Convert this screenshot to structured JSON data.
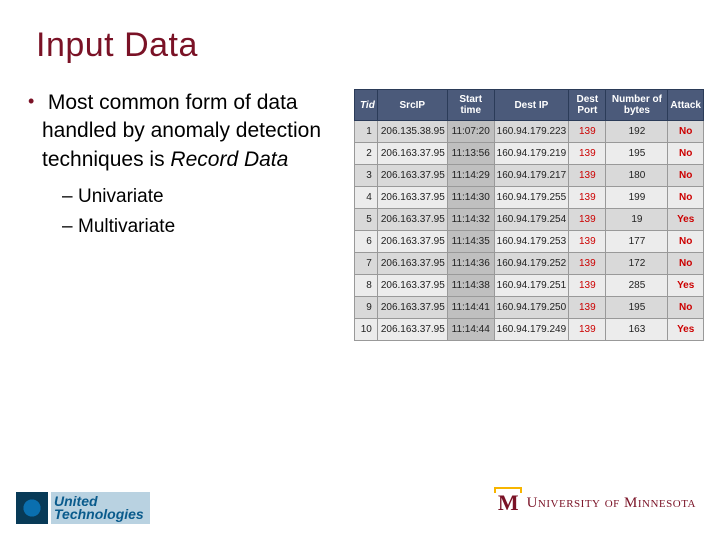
{
  "title": "Input Data",
  "bullets": {
    "main_prefix": "Most common form of data handled by anomaly detection techniques is ",
    "main_emph": "Record Data",
    "sub1": "Univariate",
    "sub2": "Multivariate"
  },
  "table": {
    "headers": {
      "tid": "Tid",
      "srcip": "SrcIP",
      "stime": "Start time",
      "destip": "Dest IP",
      "destport": "Dest Port",
      "nbytes": "Number of bytes",
      "attack": "Attack"
    },
    "rows": [
      {
        "tid": "1",
        "srcip": "206.135.38.95",
        "stime": "11:07:20",
        "destip": "160.94.179.223",
        "destport": "139",
        "nbytes": "192",
        "attack": "No"
      },
      {
        "tid": "2",
        "srcip": "206.163.37.95",
        "stime": "11:13:56",
        "destip": "160.94.179.219",
        "destport": "139",
        "nbytes": "195",
        "attack": "No"
      },
      {
        "tid": "3",
        "srcip": "206.163.37.95",
        "stime": "11:14:29",
        "destip": "160.94.179.217",
        "destport": "139",
        "nbytes": "180",
        "attack": "No"
      },
      {
        "tid": "4",
        "srcip": "206.163.37.95",
        "stime": "11:14:30",
        "destip": "160.94.179.255",
        "destport": "139",
        "nbytes": "199",
        "attack": "No"
      },
      {
        "tid": "5",
        "srcip": "206.163.37.95",
        "stime": "11:14:32",
        "destip": "160.94.179.254",
        "destport": "139",
        "nbytes": "19",
        "attack": "Yes"
      },
      {
        "tid": "6",
        "srcip": "206.163.37.95",
        "stime": "11:14:35",
        "destip": "160.94.179.253",
        "destport": "139",
        "nbytes": "177",
        "attack": "No"
      },
      {
        "tid": "7",
        "srcip": "206.163.37.95",
        "stime": "11:14:36",
        "destip": "160.94.179.252",
        "destport": "139",
        "nbytes": "172",
        "attack": "No"
      },
      {
        "tid": "8",
        "srcip": "206.163.37.95",
        "stime": "11:14:38",
        "destip": "160.94.179.251",
        "destport": "139",
        "nbytes": "285",
        "attack": "Yes"
      },
      {
        "tid": "9",
        "srcip": "206.163.37.95",
        "stime": "11:14:41",
        "destip": "160.94.179.250",
        "destport": "139",
        "nbytes": "195",
        "attack": "No"
      },
      {
        "tid": "10",
        "srcip": "206.163.37.95",
        "stime": "11:14:44",
        "destip": "160.94.179.249",
        "destport": "139",
        "nbytes": "163",
        "attack": "Yes"
      }
    ]
  },
  "footer": {
    "ut_line1": "United",
    "ut_line2": "Technologies",
    "umn_m": "M",
    "umn_text": "University of Minnesota"
  }
}
